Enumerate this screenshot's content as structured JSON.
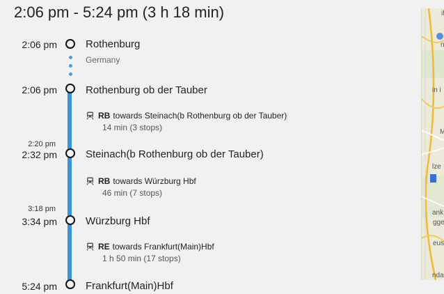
{
  "header": {
    "title": "2:06 pm - 5:24 pm (3 h 18 min)"
  },
  "stops": [
    {
      "time": "2:06 pm",
      "name": "Rothenburg",
      "sub": "Germany"
    },
    {
      "time": "2:06 pm",
      "name": "Rothenburg ob der Tauber"
    },
    {
      "arrival": "2:20 pm",
      "time": "2:32 pm",
      "name": "Steinach(b Rothenburg ob der Tauber)"
    },
    {
      "arrival": "3:18 pm",
      "time": "3:34 pm",
      "name": "Würzburg Hbf"
    },
    {
      "time": "5:24 pm",
      "name": "Frankfurt(Main)Hbf"
    }
  ],
  "segments": [
    {
      "type": "RB",
      "towards": "towards Steinach(b Rothenburg ob der Tauber)",
      "duration": "14 min (3 stops)"
    },
    {
      "type": "RB",
      "towards": "towards Würzburg Hbf",
      "duration": "46 min (7 stops)"
    },
    {
      "type": "RE",
      "towards": "towards Frankfurt(Main)Hbf",
      "duration": "1 h 50 min (17 stops)"
    }
  ],
  "colors": {
    "route_line": "#3a94d6",
    "walk_dots": "#4a9bd6"
  },
  "map_labels": [
    "ilbu",
    "n",
    "in i",
    "M",
    "lze",
    "ank",
    "gge",
    "eus",
    "nda"
  ]
}
